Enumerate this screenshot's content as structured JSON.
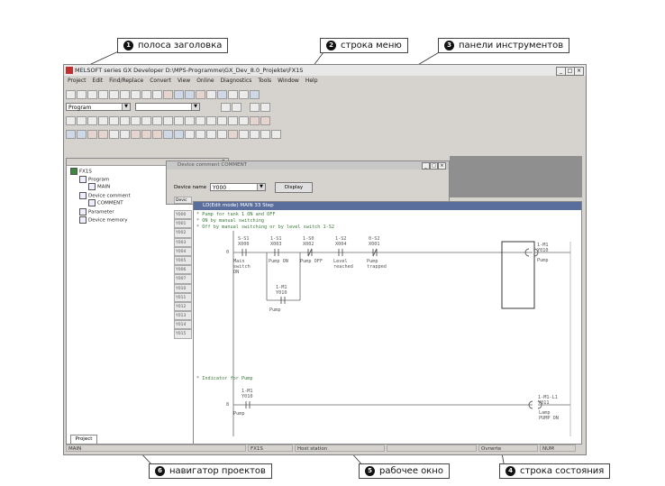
{
  "callouts": [
    {
      "num": "1",
      "label": "полоса заголовка"
    },
    {
      "num": "2",
      "label": "строка меню"
    },
    {
      "num": "3",
      "label": "панели инструментов"
    },
    {
      "num": "4",
      "label": "строка состояния"
    },
    {
      "num": "5",
      "label": "рабочее окно"
    },
    {
      "num": "6",
      "label": "навигатор проектов"
    }
  ],
  "window": {
    "title": "MELSOFT series GX Developer D:\\MPS-Programme\\GX_Dev_8.0_Projekte\\FX1S",
    "min": "_",
    "max": "□",
    "close": "×"
  },
  "menu": [
    "Project",
    "Edit",
    "Find/Replace",
    "Convert",
    "View",
    "Online",
    "Diagnostics",
    "Tools",
    "Window",
    "Help"
  ],
  "toolbar": {
    "program_combo": "Program",
    "arrow": "▼"
  },
  "navigator": {
    "root": "FX1S",
    "program": "Program",
    "main": "MAIN",
    "device_comment": "Device comment",
    "comment": "COMMENT",
    "parameter": "Parameter",
    "device_memory": "Device memory",
    "tab": "Project"
  },
  "device_comment_window": {
    "title": "Device comment COMMENT",
    "device_name_label": "Device name",
    "device_name_value": "Y000",
    "display_button": "Display",
    "col_header": "Devic",
    "devices": [
      "Y000",
      "Y001",
      "Y002",
      "Y003",
      "Y004",
      "Y005",
      "Y006",
      "Y007",
      "Y010",
      "Y011",
      "Y012",
      "Y013",
      "Y014",
      "Y015"
    ]
  },
  "ladder": {
    "title": "LD(Edit mode)   MAIN   33 Step",
    "comments": [
      "* Pump for tank 1 ON and OFF",
      "* ON by manual switching",
      "* Off by manual switching or by level switch 1-S2"
    ],
    "comment2": "* Indicator for Pump",
    "step0": "0",
    "step8": "8",
    "contacts_row1": [
      {
        "tag": "S-S1",
        "addr": "X000",
        "name": "Main\nswitch\nON"
      },
      {
        "tag": "1-S1",
        "addr": "X003",
        "name": "Pump ON"
      },
      {
        "tag": "1-S0",
        "addr": "X002",
        "name": "Pump OFF"
      },
      {
        "tag": "1-S2",
        "addr": "X004",
        "name": "Level\nreached"
      },
      {
        "tag": "0-S2",
        "addr": "X001",
        "name": "Pump\ntrapped"
      }
    ],
    "parallel": {
      "tag": "1-M1",
      "addr": "Y010",
      "name": "Pump"
    },
    "coil1": {
      "tag": "1-M1",
      "addr": "Y010",
      "name": "Pump"
    },
    "contact2": {
      "tag": "1-M1",
      "addr": "Y010",
      "name": "Pump"
    },
    "coil2": {
      "tag": "1-M1-L1",
      "addr": "Y011",
      "name": "Lamp\nPUMP ON"
    }
  },
  "status": {
    "main": "MAIN",
    "plc": "FX1S",
    "host": "Host station",
    "mode": "Ovrwrte",
    "num": "NUM"
  }
}
